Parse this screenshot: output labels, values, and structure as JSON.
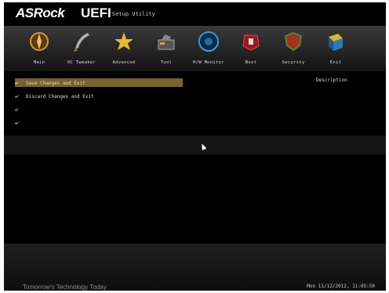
{
  "header": {
    "brand": "ASRock",
    "product": "UEFI",
    "subtitle": "Setup Utility"
  },
  "tabs": [
    {
      "label": "Main",
      "icon": "compass-icon"
    },
    {
      "label": "OC Tweaker",
      "icon": "rocket-icon"
    },
    {
      "label": "Advanced",
      "icon": "star-icon"
    },
    {
      "label": "Tool",
      "icon": "toolbox-icon"
    },
    {
      "label": "H/W Monitor",
      "icon": "monitor-eye-icon"
    },
    {
      "label": "Boot",
      "icon": "power-icon"
    },
    {
      "label": "Security",
      "icon": "shield-icon"
    },
    {
      "label": "Exit",
      "icon": "exit-box-icon"
    }
  ],
  "menu": {
    "items": [
      {
        "label": "Save Changes and Exit",
        "selected": true
      },
      {
        "label": "Discard Changes and Exit",
        "selected": false
      },
      {
        "label": "",
        "selected": false
      },
      {
        "label": "",
        "selected": false
      }
    ]
  },
  "description": {
    "title": "Description"
  },
  "footer": {
    "tagline": "Tomorrow's Technology Today",
    "datetime": "Mon 11/12/2012, 11:05:50"
  },
  "colors": {
    "selected_bar": "#7a6228",
    "background": "#000000"
  }
}
